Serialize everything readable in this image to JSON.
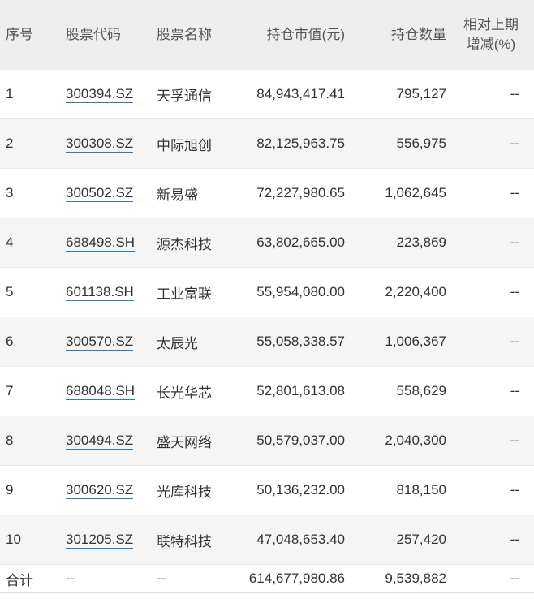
{
  "headers": {
    "index": "序号",
    "code": "股票代码",
    "name": "股票名称",
    "value": "持仓市值(元)",
    "quantity": "持仓数量",
    "change_line1": "相对上期",
    "change_line2": "增减(%)"
  },
  "rows": [
    {
      "index": "1",
      "code": "300394.SZ",
      "name": "天孚通信",
      "value": "84,943,417.41",
      "quantity": "795,127",
      "change": "--"
    },
    {
      "index": "2",
      "code": "300308.SZ",
      "name": "中际旭创",
      "value": "82,125,963.75",
      "quantity": "556,975",
      "change": "--"
    },
    {
      "index": "3",
      "code": "300502.SZ",
      "name": "新易盛",
      "value": "72,227,980.65",
      "quantity": "1,062,645",
      "change": "--"
    },
    {
      "index": "4",
      "code": "688498.SH",
      "name": "源杰科技",
      "value": "63,802,665.00",
      "quantity": "223,869",
      "change": "--"
    },
    {
      "index": "5",
      "code": "601138.SH",
      "name": "工业富联",
      "value": "55,954,080.00",
      "quantity": "2,220,400",
      "change": "--"
    },
    {
      "index": "6",
      "code": "300570.SZ",
      "name": "太辰光",
      "value": "55,058,338.57",
      "quantity": "1,006,367",
      "change": "--"
    },
    {
      "index": "7",
      "code": "688048.SH",
      "name": "长光华芯",
      "value": "52,801,613.08",
      "quantity": "558,629",
      "change": "--"
    },
    {
      "index": "8",
      "code": "300494.SZ",
      "name": "盛天网络",
      "value": "50,579,037.00",
      "quantity": "2,040,300",
      "change": "--"
    },
    {
      "index": "9",
      "code": "300620.SZ",
      "name": "光库科技",
      "value": "50,136,232.00",
      "quantity": "818,150",
      "change": "--"
    },
    {
      "index": "10",
      "code": "301205.SZ",
      "name": "联特科技",
      "value": "47,048,653.40",
      "quantity": "257,420",
      "change": "--"
    }
  ],
  "total": {
    "label": "合计",
    "code": "--",
    "name": "--",
    "value": "614,677,980.86",
    "quantity": "9,539,882",
    "change": "--"
  },
  "colors": {
    "header_bg": "#eeeeee",
    "stripe_bg": "#f5f5f5",
    "link_underline": "#2b7bbf",
    "text": "#333333"
  }
}
